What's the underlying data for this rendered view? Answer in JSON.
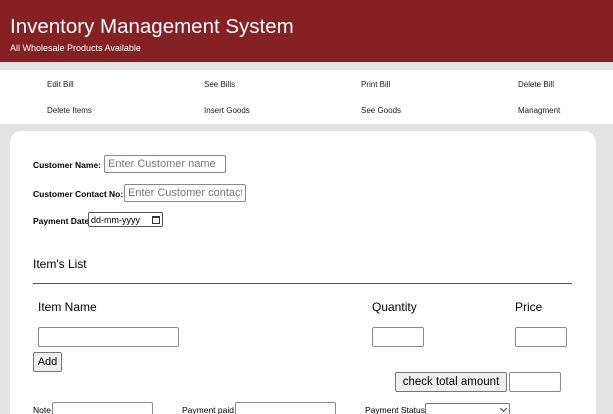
{
  "header": {
    "title": "Inventory Management System",
    "subtitle": "All Wholesale Products Available"
  },
  "nav": {
    "items": [
      "Edit Bill",
      "See Bills",
      "Print Bill",
      "Delete Bill",
      "Delete Items",
      "Insert Goods",
      "See Goods",
      "Managment"
    ]
  },
  "form": {
    "customer_name_label": "Customer Name:",
    "customer_name_placeholder": "Enter Customer name",
    "contact_label": "Customer Contact No:",
    "contact_placeholder": "Enter Customer contact No",
    "payment_date_label": "Payment Date",
    "payment_date_value": "dd-mm-yyyy"
  },
  "items": {
    "title": "Item's List",
    "col_item_name": "Item Name",
    "col_quantity": "Quantity",
    "col_price": "Price",
    "add_label": "Add",
    "check_total_label": "check total amount"
  },
  "footer_fields": {
    "note_label": "Note",
    "payment_paid_label": "Payment paid",
    "payment_status_label": "Payment Status"
  }
}
